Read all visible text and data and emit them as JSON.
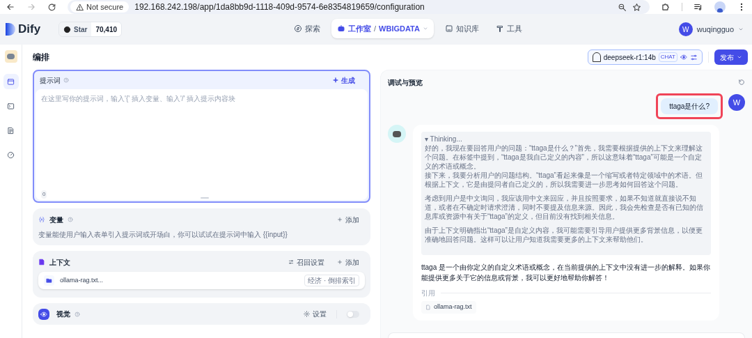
{
  "browser": {
    "security": "Not secure",
    "url": "192.168.242.198/app/1da8bb9d-1118-409d-9574-6e8354819659/configuration"
  },
  "header": {
    "logo": "Dify",
    "github": {
      "label": "Star",
      "count": "70,410"
    },
    "nav": [
      {
        "kind": "explore",
        "label": "探索",
        "selected": false
      },
      {
        "kind": "studio",
        "label": "工作室",
        "separator": "/",
        "workspace": "WBIGDATA",
        "selected": true
      },
      {
        "kind": "knowledge",
        "label": "知识库",
        "selected": false
      },
      {
        "kind": "tools",
        "label": "工具",
        "selected": false
      }
    ],
    "user": {
      "initial": "W",
      "name": "wuqingguo"
    }
  },
  "sidebar": {
    "items": [
      {
        "kind": "orchestrate",
        "selected": true
      },
      {
        "kind": "logs",
        "selected": false
      },
      {
        "kind": "annotations",
        "selected": false
      },
      {
        "kind": "monitor",
        "selected": false
      }
    ]
  },
  "page_title": "编排",
  "model": {
    "name": "deepseek-r1:14b",
    "tag": "CHAT"
  },
  "publish_button": "发布",
  "prompt": {
    "title": "提示词",
    "generate": "生成",
    "placeholder": "在这里写你的提示词，输入'{' 插入变量、输入'/' 插入提示内容块",
    "count": "0"
  },
  "variables": {
    "title": "变量",
    "add": "添加",
    "hint": "变量能使用户输入表单引入提示词或开场白，你可以试试在提示词中输入 {{input}}"
  },
  "context": {
    "title": "上下文",
    "retrieval": "召回设置",
    "add": "添加",
    "files": [
      {
        "name": "ollama-rag.txt...",
        "tag": "经济 · 倒排索引"
      }
    ]
  },
  "vision": {
    "title": "视觉",
    "settings": "设置",
    "on": false
  },
  "preview": {
    "title": "调试与预览",
    "messages": [
      {
        "kind": "user",
        "initial": "W",
        "text": "ttaga是什么?",
        "highlighted": true
      },
      {
        "kind": "bot",
        "thinking_label": "▾ Thinking...",
        "thinking": [
          [
            "好的，我现在要回答用户的问题：“ttaga是什么？”首先，我需要根据提供的上下文来理解这个问题。在标签中提到，“ttaga是我自己定义的内容”，所以这意味着“ttaga”可能是一个自定义的术语或概念。",
            "接下来，我要分析用户的问题结构。“ttaga”看起来像是一个缩写或者特定领域中的术语。但根据上下文，它是由提问者自己定义的，所以我需要进一步思考如何回答这个问题。"
          ],
          [
            "考虑到用户是中文询问，我应该用中文来回应，并且按照要求，如果不知道就直接说不知道，或者在不确定时请求澄清，同时不要提及信息来源。因此，我会先检查是否有已知的信息库或资源中有关于“ttaga”的定义，但目前没有找到相关信息。"
          ],
          [
            "由于上下文明确指出“ttaga”是自定义内容，我可能需要引导用户提供更多背景信息，以便更准确地回答问题。这样可以让用户知道我需要更多的上下文来帮助他们。"
          ]
        ],
        "answer": "ttaga 是一个由你定义的自定义术语或概念，在当前提供的上下文中没有进一步的解释。如果你能提供更多关于它的信息或背景，我可以更好地帮助你解答！",
        "citation_label": "引用",
        "citations": [
          "ollama-rag.txt"
        ]
      }
    ]
  }
}
